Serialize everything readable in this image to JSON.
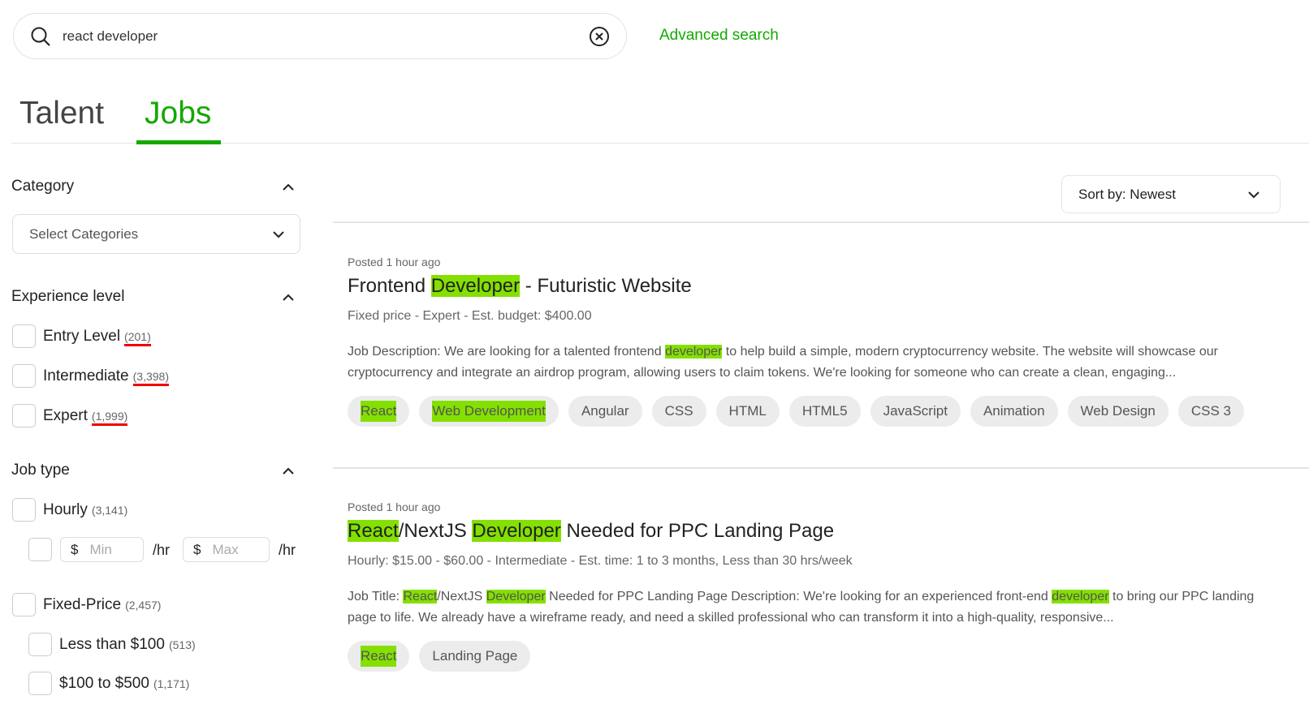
{
  "search": {
    "value": "react developer",
    "advanced": "Advanced search"
  },
  "tabs": [
    {
      "label": "Talent"
    },
    {
      "label": "Jobs"
    }
  ],
  "accent": "#14a800",
  "highlight": "#84e000",
  "filters": {
    "category": {
      "title": "Category",
      "placeholder": "Select Categories"
    },
    "experience": {
      "title": "Experience level",
      "options": [
        {
          "label": "Entry Level",
          "count": "(201)"
        },
        {
          "label": "Intermediate",
          "count": "(3,398)"
        },
        {
          "label": "Expert",
          "count": "(1,999)"
        }
      ]
    },
    "jobtype": {
      "title": "Job type",
      "hourly": {
        "label": "Hourly",
        "count": "(3,141)"
      },
      "currency": "$",
      "min": "Min",
      "max": "Max",
      "unit": "/hr",
      "fixed": {
        "label": "Fixed-Price",
        "count": "(2,457)"
      },
      "ranges": [
        {
          "label": "Less than $100",
          "count": "(513)"
        },
        {
          "label": "$100 to $500",
          "count": "(1,171)"
        }
      ]
    }
  },
  "sort": {
    "label": "Sort by: Newest"
  },
  "jobs": [
    {
      "posted": "Posted 1 hour ago",
      "title": [
        {
          "t": "Frontend "
        },
        {
          "t": "Developer",
          "h": true
        },
        {
          "t": " - Futuristic Website"
        }
      ],
      "meta": "Fixed price - Expert - Est. budget: $400.00",
      "desc": [
        {
          "t": "Job Description: We are looking for a talented frontend "
        },
        {
          "t": "developer",
          "h": true
        },
        {
          "t": " to help build a simple, modern cryptocurrency website. The website will showcase our cryptocurrency and integrate an airdrop program, allowing users to claim tokens. We're looking for someone who can create a clean, engaging..."
        }
      ],
      "tags": [
        {
          "label": "React",
          "h": true
        },
        {
          "label": "Web Development",
          "h": true
        },
        {
          "label": "Angular"
        },
        {
          "label": "CSS"
        },
        {
          "label": "HTML"
        },
        {
          "label": "HTML5"
        },
        {
          "label": "JavaScript"
        },
        {
          "label": "Animation"
        },
        {
          "label": "Web Design"
        },
        {
          "label": "CSS 3"
        }
      ]
    },
    {
      "posted": "Posted 1 hour ago",
      "title": [
        {
          "t": "React",
          "h": true
        },
        {
          "t": "/NextJS "
        },
        {
          "t": "Developer",
          "h": true
        },
        {
          "t": " Needed for PPC Landing Page"
        }
      ],
      "meta": "Hourly: $15.00 - $60.00 - Intermediate - Est. time: 1 to 3 months, Less than 30 hrs/week",
      "desc": [
        {
          "t": "Job Title: "
        },
        {
          "t": "React",
          "h": true
        },
        {
          "t": "/NextJS "
        },
        {
          "t": "Developer",
          "h": true
        },
        {
          "t": " Needed for PPC Landing Page Description: We're looking for an experienced front-end "
        },
        {
          "t": "developer",
          "h": true
        },
        {
          "t": " to bring our PPC landing page to life. We already have a wireframe ready, and need a skilled professional who can transform it into a high-quality, responsive..."
        }
      ],
      "tags": [
        {
          "label": "React",
          "h": true
        },
        {
          "label": "Landing Page"
        }
      ]
    }
  ]
}
